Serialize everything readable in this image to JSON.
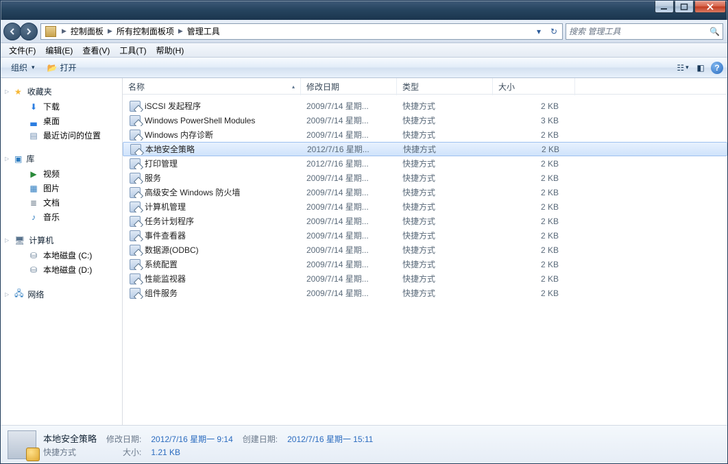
{
  "breadcrumbs": [
    "控制面板",
    "所有控制面板项",
    "管理工具"
  ],
  "search_placeholder": "搜索 管理工具",
  "menus": {
    "file": "文件(F)",
    "edit": "编辑(E)",
    "view": "查看(V)",
    "tools": "工具(T)",
    "help": "帮助(H)"
  },
  "toolbar": {
    "organize": "组织",
    "open": "打开"
  },
  "sidebar": {
    "favorites_label": "收藏夹",
    "favorites": [
      {
        "label": "下载",
        "icon": "⬇",
        "color": "#2b7de1"
      },
      {
        "label": "桌面",
        "icon": "▃",
        "color": "#2b7de1"
      },
      {
        "label": "最近访问的位置",
        "icon": "▤",
        "color": "#6a8aae"
      }
    ],
    "libraries_label": "库",
    "libraries": [
      {
        "label": "视频",
        "icon": "▶",
        "color": "#2a8a3a"
      },
      {
        "label": "图片",
        "icon": "▦",
        "color": "#2a7abf"
      },
      {
        "label": "文档",
        "icon": "≣",
        "color": "#6a7a8a"
      },
      {
        "label": "音乐",
        "icon": "♪",
        "color": "#2a7abf"
      }
    ],
    "computer_label": "计算机",
    "drives": [
      {
        "label": "本地磁盘 (C:)",
        "icon": "⛁"
      },
      {
        "label": "本地磁盘 (D:)",
        "icon": "⛁"
      }
    ],
    "network_label": "网络"
  },
  "columns": {
    "name": "名称",
    "date": "修改日期",
    "type": "类型",
    "size": "大小"
  },
  "selected_index": 3,
  "rows": [
    {
      "name": "iSCSI 发起程序",
      "date": "2009/7/14 星期...",
      "type": "快捷方式",
      "size": "2 KB"
    },
    {
      "name": "Windows PowerShell Modules",
      "date": "2009/7/14 星期...",
      "type": "快捷方式",
      "size": "3 KB"
    },
    {
      "name": "Windows 内存诊断",
      "date": "2009/7/14 星期...",
      "type": "快捷方式",
      "size": "2 KB"
    },
    {
      "name": "本地安全策略",
      "date": "2012/7/16 星期...",
      "type": "快捷方式",
      "size": "2 KB"
    },
    {
      "name": "打印管理",
      "date": "2012/7/16 星期...",
      "type": "快捷方式",
      "size": "2 KB"
    },
    {
      "name": "服务",
      "date": "2009/7/14 星期...",
      "type": "快捷方式",
      "size": "2 KB"
    },
    {
      "name": "高级安全 Windows 防火墙",
      "date": "2009/7/14 星期...",
      "type": "快捷方式",
      "size": "2 KB"
    },
    {
      "name": "计算机管理",
      "date": "2009/7/14 星期...",
      "type": "快捷方式",
      "size": "2 KB"
    },
    {
      "name": "任务计划程序",
      "date": "2009/7/14 星期...",
      "type": "快捷方式",
      "size": "2 KB"
    },
    {
      "name": "事件查看器",
      "date": "2009/7/14 星期...",
      "type": "快捷方式",
      "size": "2 KB"
    },
    {
      "name": "数据源(ODBC)",
      "date": "2009/7/14 星期...",
      "type": "快捷方式",
      "size": "2 KB"
    },
    {
      "name": "系统配置",
      "date": "2009/7/14 星期...",
      "type": "快捷方式",
      "size": "2 KB"
    },
    {
      "name": "性能监视器",
      "date": "2009/7/14 星期...",
      "type": "快捷方式",
      "size": "2 KB"
    },
    {
      "name": "组件服务",
      "date": "2009/7/14 星期...",
      "type": "快捷方式",
      "size": "2 KB"
    }
  ],
  "details": {
    "title": "本地安全策略",
    "subtitle": "快捷方式",
    "mod_label": "修改日期:",
    "mod_val": "2012/7/16 星期一 9:14",
    "create_label": "创建日期:",
    "create_val": "2012/7/16 星期一 15:11",
    "size_label": "大小:",
    "size_val": "1.21 KB"
  }
}
